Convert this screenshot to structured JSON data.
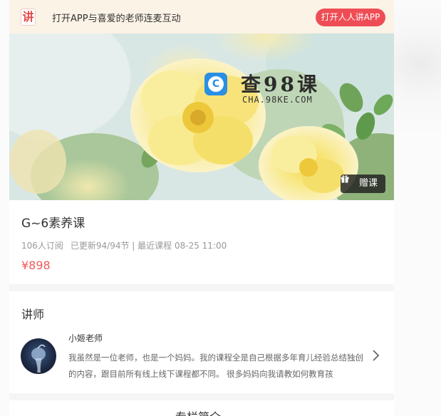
{
  "banner": {
    "logo_char": "讲",
    "text": "打开APP与喜爱的老师连麦互动",
    "open_button": "打开人人讲APP"
  },
  "hero": {
    "watermark_title": "查98课",
    "watermark_sub": "CHA.98KE.COM",
    "gift_label": "赠课"
  },
  "course": {
    "title": "G~6素养课",
    "subscribers": "106人订阅",
    "updated": "已更新94/94节 | 最近课程 08-25 11:00",
    "price": "¥898"
  },
  "teacher": {
    "heading": "讲师",
    "name": "小姬老师",
    "description": "我虽然是一位老师，也是一个妈妈。我的课程全是自己根据多年育儿经验总结独创的内容，跟目前所有线上线下课程都不同。 很多妈妈向我请教如何教育孩"
  },
  "next_section": {
    "title": "专栏简介"
  }
}
